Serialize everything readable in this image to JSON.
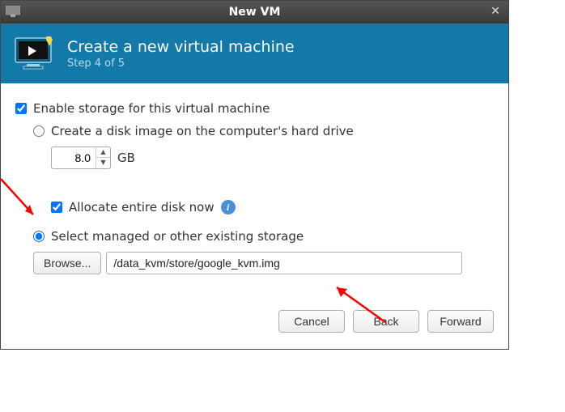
{
  "window": {
    "title": "New VM"
  },
  "header": {
    "title": "Create a new virtual machine",
    "step": "Step 4 of 5"
  },
  "storage": {
    "enable_label": "Enable storage for this virtual machine",
    "create_disk_label": "Create a disk image on the computer's hard drive",
    "size_value": "8.0",
    "size_unit": "GB",
    "allocate_now_label": "Allocate entire disk now",
    "select_managed_label": "Select managed or other existing storage",
    "browse_label": "Browse...",
    "path_value": "/data_kvm/store/google_kvm.img"
  },
  "buttons": {
    "cancel": "Cancel",
    "back": "Back",
    "forward": "Forward"
  }
}
